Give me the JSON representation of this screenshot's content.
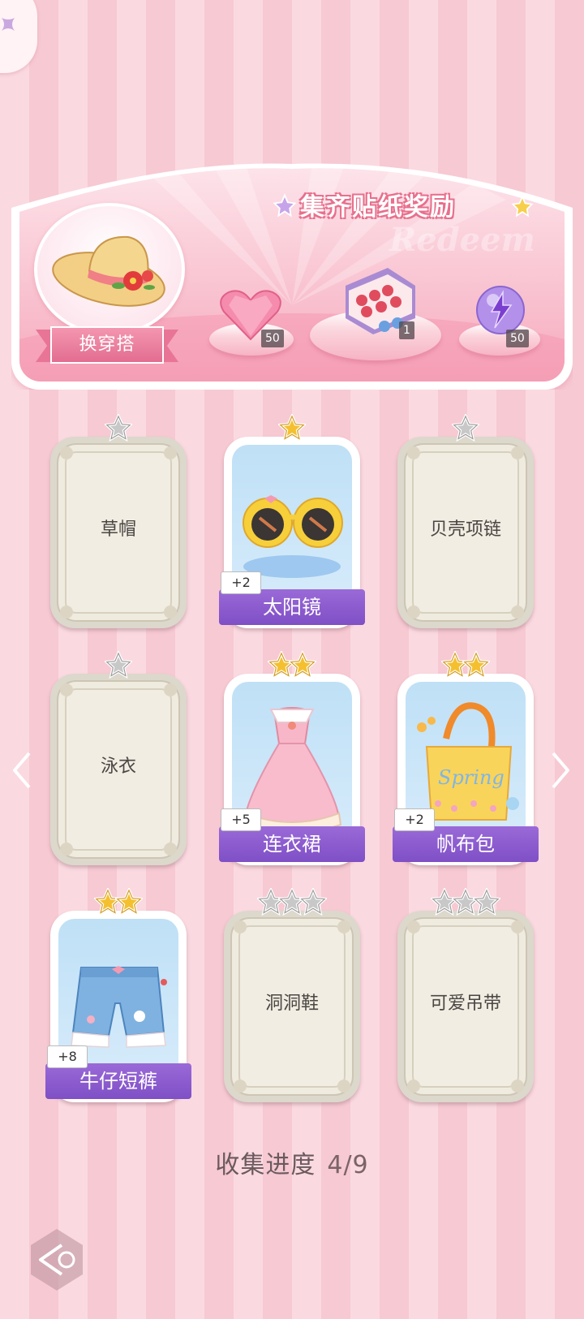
{
  "banner": {
    "title": "集齐贴纸奖励",
    "watermark": "Redeem",
    "outfit_button": "换穿搭",
    "rewards": [
      {
        "icon": "heart-gem-icon",
        "count": "50"
      },
      {
        "icon": "gift-box-icon",
        "count": "1"
      },
      {
        "icon": "energy-orb-icon",
        "count": "50"
      }
    ]
  },
  "cards": [
    {
      "name": "草帽",
      "stars": 1,
      "filled": false,
      "unlocked": false
    },
    {
      "name": "太阳镜",
      "stars": 1,
      "filled": true,
      "unlocked": true,
      "bonus": "+2",
      "icon": "sunglasses-icon"
    },
    {
      "name": "贝壳项链",
      "stars": 1,
      "filled": false,
      "unlocked": false
    },
    {
      "name": "泳衣",
      "stars": 1,
      "filled": false,
      "unlocked": false
    },
    {
      "name": "连衣裙",
      "stars": 2,
      "filled": true,
      "unlocked": true,
      "bonus": "+5",
      "icon": "dress-icon"
    },
    {
      "name": "帆布包",
      "stars": 2,
      "filled": true,
      "unlocked": true,
      "bonus": "+2",
      "icon": "tote-bag-icon"
    },
    {
      "name": "牛仔短裤",
      "stars": 2,
      "filled": true,
      "unlocked": true,
      "bonus": "+8",
      "icon": "denim-shorts-icon"
    },
    {
      "name": "洞洞鞋",
      "stars": 3,
      "filled": false,
      "unlocked": false
    },
    {
      "name": "可爱吊带",
      "stars": 3,
      "filled": false,
      "unlocked": false
    }
  ],
  "progress": {
    "label": "收集进度",
    "value": "4/9"
  },
  "colors": {
    "gold_star": "#f5c030",
    "grey_star": "#c8c8c8",
    "banner_purple": "#8a5bcf",
    "pink": "#e87596"
  }
}
